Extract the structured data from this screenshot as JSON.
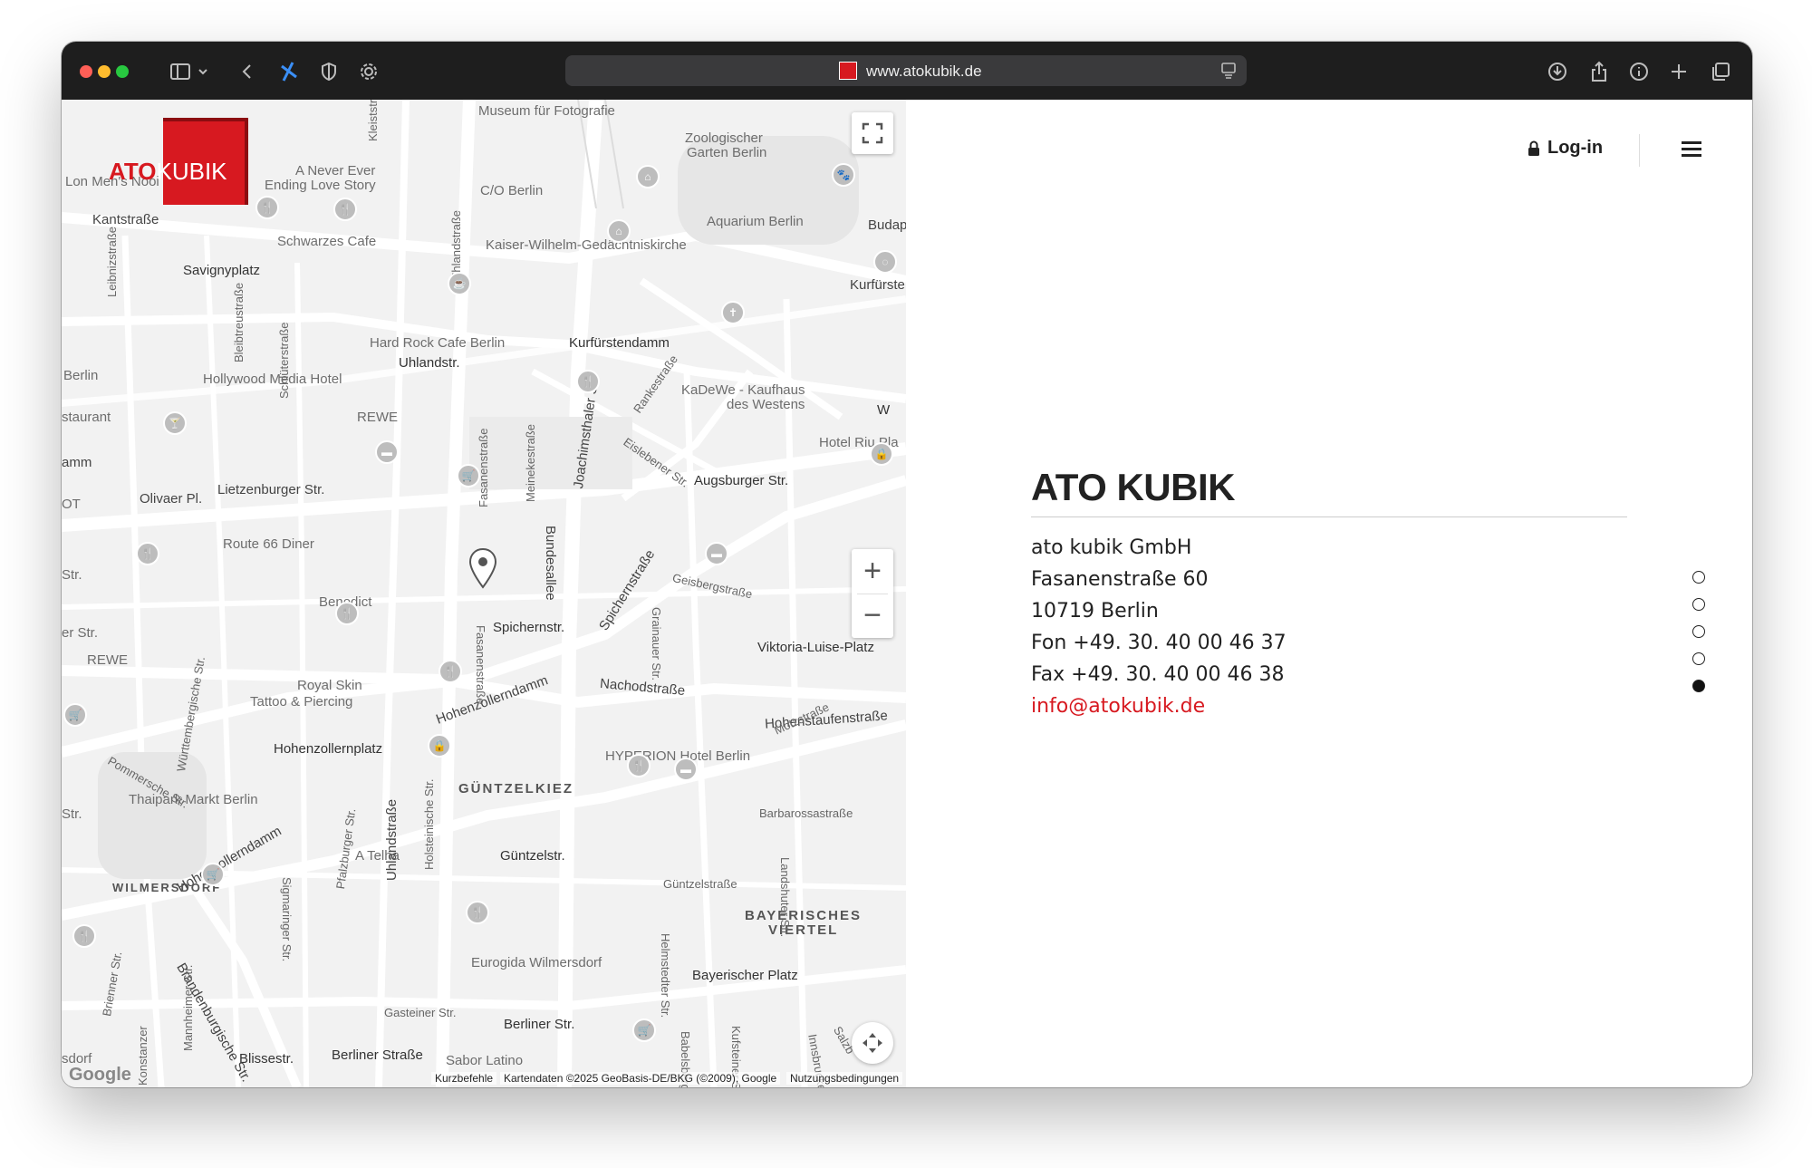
{
  "browser": {
    "url": "www.atokubik.de"
  },
  "map": {
    "labels": [
      "Museum für Fotografie",
      "Zoologischer",
      "Garten Berlin",
      "A Never Ever",
      "Ending Love Story",
      "C/O Berlin",
      "Lon Men's Nooi",
      "Kantstraße",
      "Aquarium Berlin",
      "Schwarzes Cafe",
      "Kaiser-Wilhelm-Gedächtniskirche",
      "Budap",
      "Savignyplatz",
      "Kurfürste",
      "Hard Rock Cafe Berlin",
      "Kurfürstendamm",
      "Uhlandstr.",
      "Berlin",
      "Hollywood Media Hotel",
      "KaDeWe - Kaufhaus",
      "des Westens",
      "staurant",
      "REWE",
      "Hotel Riu Pla",
      "amm",
      "Olivaer Pl.",
      "Lietzenburger Str.",
      "Augsburger Str.",
      "OT",
      "Route 66 Diner",
      "Benedict",
      "Spichernstr.",
      "Viktoria-Luise-Platz",
      "REWE",
      "Royal Skin",
      "Tattoo & Piercing",
      "Hohenzollerndamm",
      "Nachodstraße",
      "Hohenstaufenstraße",
      "Hohenzollernplatz",
      "HYPERION Hotel Berlin",
      "GÜNTZELKIEZ",
      "Thaipark Markt Berlin",
      "Hohenzollerndamm",
      "A Telha",
      "Güntzelstr.",
      "WILMERSDORF",
      "BAYERISCHES",
      "VIERTEL",
      "Eurogida Wilmersdorf",
      "Bayerischer Platz",
      "Berliner Str.",
      "Blissestr.",
      "Berliner Straße",
      "Sabor Latino",
      "sdorf",
      "Gasteiner Str.",
      "Güntzelstraße",
      "Barbarossastraße"
    ],
    "streets": [
      "Leibnizstraße",
      "Schlüterstraße",
      "Bleibtreustraße",
      "Uhlandstraße",
      "Fasanenstraße",
      "Meinekestraße",
      "Joachimsthaler Str.",
      "Rankestraße",
      "Eislebener Str.",
      "Bundesallee",
      "Spichernstraße",
      "Geisbergstraße",
      "Fasanenstraße",
      "Grainauer Str.",
      "Motzstraße",
      "Württembergische Str.",
      "Pommersche Str.",
      "Uhlandstraße",
      "Holsteinische Str.",
      "Pfalzburger Str.",
      "Sigmaringer Str.",
      "Landshuter Str.",
      "Helmstedter Str.",
      "Babelsberger",
      "Kufsteiner Str.",
      "Innsbrucker",
      "Salzb",
      "Brandenburgische Str.",
      "Mannheimer Str.",
      "Brienner Str.",
      "Konstanzer",
      "Kleiststr",
      "W",
      "Str.",
      "Str.",
      "er Str."
    ],
    "footer": {
      "shortcuts": "Kurzbefehle",
      "data": "Kartendaten ©2025 GeoBasis-DE/BKG (©2009), Google",
      "terms": "Nutzungsbedingungen",
      "google": "Google"
    },
    "controls": {
      "zoom_in": "+",
      "zoom_out": "−"
    }
  },
  "logo": {
    "ato": "ATO",
    "kubik": "KUBIK"
  },
  "header": {
    "login": "Log-in"
  },
  "contact": {
    "title": "ATO KUBIK",
    "company": "ato kubik GmbH",
    "street": "Fasanenstraße 60",
    "city": "10719 Berlin",
    "fon": "Fon +49. 30. 40 00 46 37",
    "fax": "Fax +49. 30. 40 00 46 38",
    "email": "info@atokubik.de"
  },
  "section_nav": {
    "count": 5,
    "active_index": 4
  },
  "colors": {
    "brand_red": "#d71920",
    "toolbar": "#1e1e1e"
  }
}
